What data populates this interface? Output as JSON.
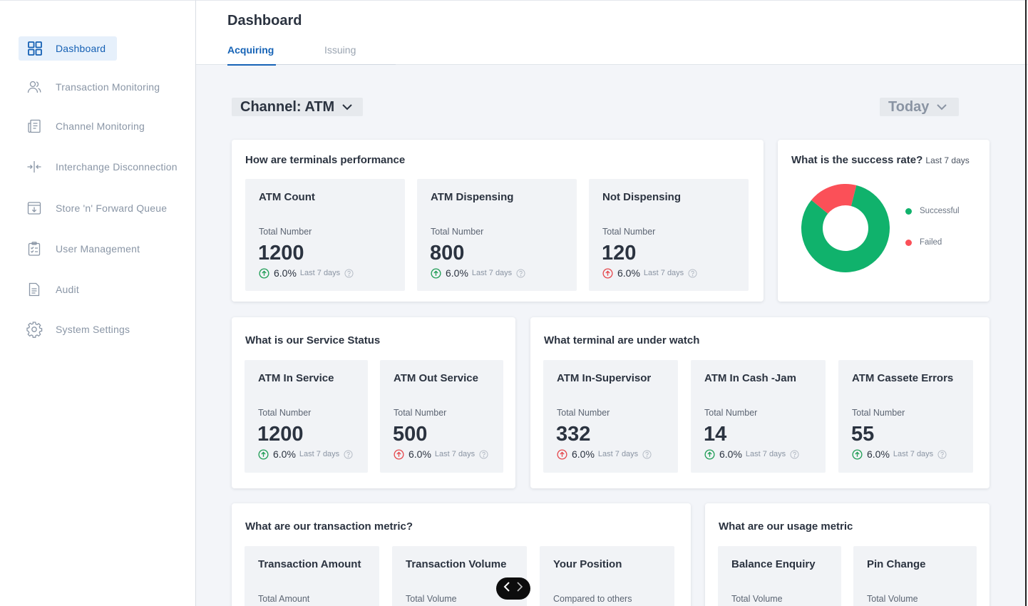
{
  "sidebar": {
    "items": [
      {
        "label": "Dashboard",
        "icon": "grid-icon"
      },
      {
        "label": "Transaction Monitoring",
        "icon": "users-icon"
      },
      {
        "label": "Channel Monitoring",
        "icon": "document-icon"
      },
      {
        "label": "Interchange Disconnection",
        "icon": "disconnect-icon"
      },
      {
        "label": "Store 'n' Forward Queue",
        "icon": "download-box-icon"
      },
      {
        "label": "User Management",
        "icon": "clipboard-check-icon"
      },
      {
        "label": "Audit",
        "icon": "file-icon"
      },
      {
        "label": "System Settings",
        "icon": "gear-icon"
      }
    ]
  },
  "header": {
    "title": "Dashboard",
    "tabs": [
      {
        "label": "Acquiring"
      },
      {
        "label": "Issuing"
      }
    ]
  },
  "filters": {
    "channel": "Channel: ATM",
    "period": "Today"
  },
  "colors": {
    "accent": "#1663b6",
    "up": "#1f9d55",
    "down": "#e5484d",
    "successful": "#10b26c",
    "failed": "#fb5058"
  },
  "terminals": {
    "title": "How are terminals performance",
    "stats": [
      {
        "title": "ATM Count",
        "label": "Total Number",
        "value": "1200",
        "change": "6.0%",
        "period": "Last 7 days",
        "trend": "up"
      },
      {
        "title": "ATM Dispensing",
        "label": "Total Number",
        "value": "800",
        "change": "6.0%",
        "period": "Last 7 days",
        "trend": "up"
      },
      {
        "title": "Not Dispensing",
        "label": "Total Number",
        "value": "120",
        "change": "6.0%",
        "period": "Last 7 days",
        "trend": "down"
      }
    ]
  },
  "success_rate": {
    "title": "What is the success rate?",
    "subtitle": "Last 7 days",
    "legend": [
      "Successful",
      "Failed"
    ]
  },
  "chart_data": {
    "type": "pie",
    "categories": [
      "Successful",
      "Failed"
    ],
    "values": [
      82,
      18
    ],
    "colors": [
      "#10b26c",
      "#fb5058"
    ],
    "donut": true,
    "legend_position": "right"
  },
  "service_status": {
    "title": "What is our Service Status",
    "stats": [
      {
        "title": "ATM In Service",
        "label": "Total Number",
        "value": "1200",
        "change": "6.0%",
        "period": "Last 7 days",
        "trend": "up"
      },
      {
        "title": "ATM Out Service",
        "label": "Total Number",
        "value": "500",
        "change": "6.0%",
        "period": "Last 7 days",
        "trend": "down"
      }
    ]
  },
  "under_watch": {
    "title": "What terminal are under watch",
    "stats": [
      {
        "title": "ATM In-Supervisor",
        "label": "Total Number",
        "value": "332",
        "change": "6.0%",
        "period": "Last 7 days",
        "trend": "down"
      },
      {
        "title": "ATM In Cash -Jam",
        "label": "Total Number",
        "value": "14",
        "change": "6.0%",
        "period": "Last 7 days",
        "trend": "up"
      },
      {
        "title": "ATM Cassete Errors",
        "label": "Total Number",
        "value": "55",
        "change": "6.0%",
        "period": "Last 7 days",
        "trend": "up"
      }
    ]
  },
  "transaction_metric": {
    "title": "What are our transaction metric?",
    "stats": [
      {
        "title": "Transaction Amount",
        "label": "Total Amount"
      },
      {
        "title": "Transaction Volume",
        "label": "Total Volume"
      },
      {
        "title": "Your Position",
        "label": "Compared to others"
      }
    ]
  },
  "usage_metric": {
    "title": "What are our usage metric",
    "stats": [
      {
        "title": "Balance Enquiry",
        "label": "Total Volume"
      },
      {
        "title": "Pin Change",
        "label": "Total Volume"
      }
    ]
  }
}
